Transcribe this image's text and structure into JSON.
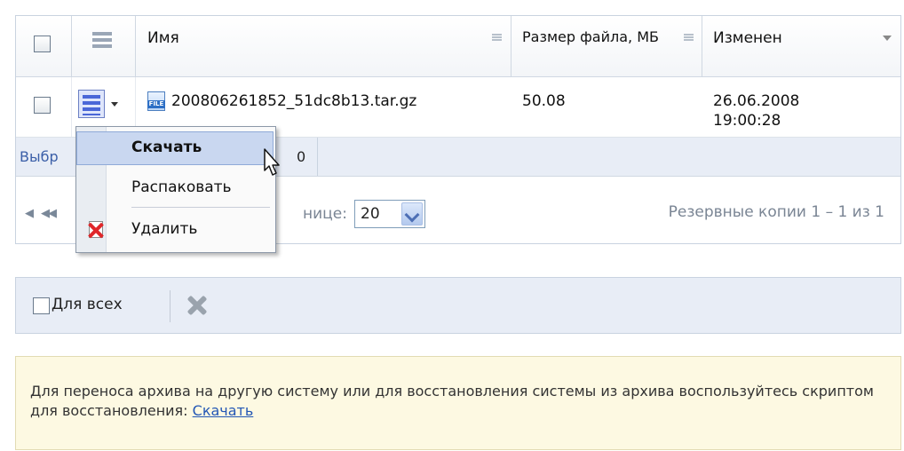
{
  "grid": {
    "columns": {
      "name": "Имя",
      "size": "Размер файла, МБ",
      "modified": "Изменен"
    },
    "rows": [
      {
        "file_icon_label": "FILE",
        "name": "200806261852_51dc8b13.tar.gz",
        "size": "50.08",
        "modified_date": "26.06.2008",
        "modified_time": "19:00:28"
      }
    ],
    "selected_label_visible": "Выбр",
    "selected_count_visible": "0"
  },
  "pager": {
    "first": "◀",
    "prev": "◀◀",
    "per_page_label_visible": "нице:",
    "per_page_value": "20",
    "info": "Резервные копии 1 – 1 из 1"
  },
  "toolbar": {
    "for_all_label": "Для всех"
  },
  "context_menu": {
    "items": [
      {
        "label": "Скачать"
      },
      {
        "label": "Распаковать"
      },
      {
        "label": "Удалить"
      }
    ]
  },
  "note": {
    "text": "Для переноса архива на другую систему или для восстановления системы из архива воспользуйтесь скриптом для восстановления: ",
    "link": "Скачать"
  },
  "icons": {
    "row_checkbox": "checkbox-icon",
    "actions": "actions-menu-icon",
    "file": "file-archive-icon",
    "delete": "delete-icon",
    "cursor": "mouse-pointer-icon"
  },
  "colors": {
    "accent": "#3b5fa8",
    "header_bg": "#f3f5f8",
    "selection_bg": "#e8edf6",
    "note_bg": "#fdf9e2",
    "menu_active": "#c9d7f0"
  }
}
